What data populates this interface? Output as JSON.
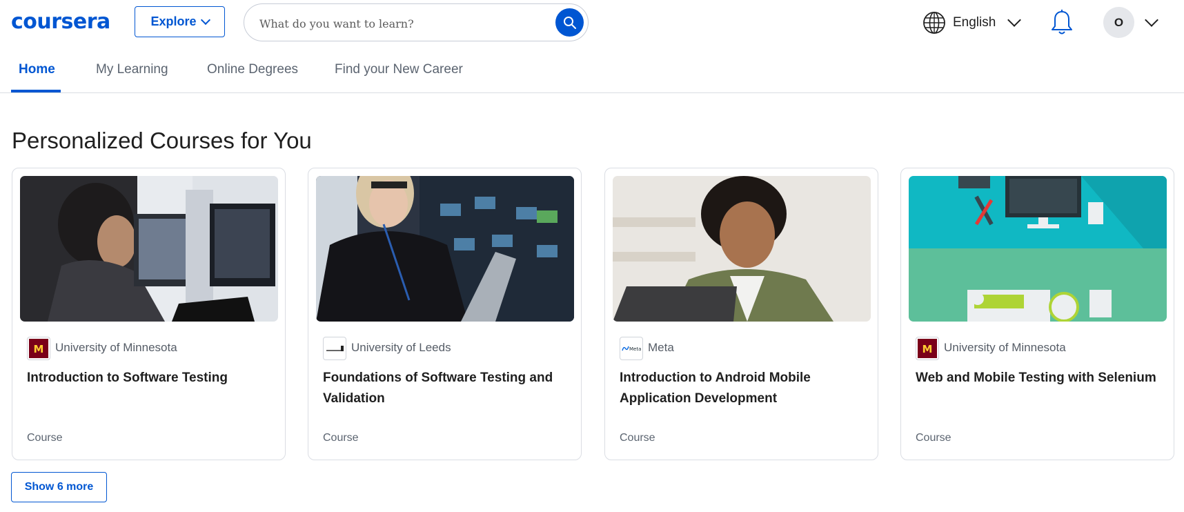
{
  "brand": {
    "logo_text": "coursera",
    "color": "#0056d2"
  },
  "header": {
    "explore_label": "Explore",
    "search": {
      "placeholder": "What do you want to learn?"
    },
    "language": "English",
    "avatar_initial": "O"
  },
  "tabs": [
    {
      "label": "Home",
      "active": true
    },
    {
      "label": "My Learning",
      "active": false
    },
    {
      "label": "Online Degrees",
      "active": false
    },
    {
      "label": "Find your New Career",
      "active": false
    }
  ],
  "section": {
    "title": "Personalized Courses for You"
  },
  "cards": [
    {
      "partner": "University of Minnesota",
      "partner_logo": "minnesota-logo",
      "title": "Introduction to Software Testing",
      "type": "Course"
    },
    {
      "partner": "University of Leeds",
      "partner_logo": "leeds-logo",
      "title": "Foundations of Software Testing and Validation",
      "type": "Course"
    },
    {
      "partner": "Meta",
      "partner_logo": "meta-logo",
      "meta_logo_text": "Meta",
      "title": "Introduction to Android Mobile Application Development",
      "type": "Course"
    },
    {
      "partner": "University of Minnesota",
      "partner_logo": "minnesota-logo",
      "title": "Web and Mobile Testing with Selenium",
      "type": "Course"
    }
  ],
  "show_more_label": "Show 6 more"
}
